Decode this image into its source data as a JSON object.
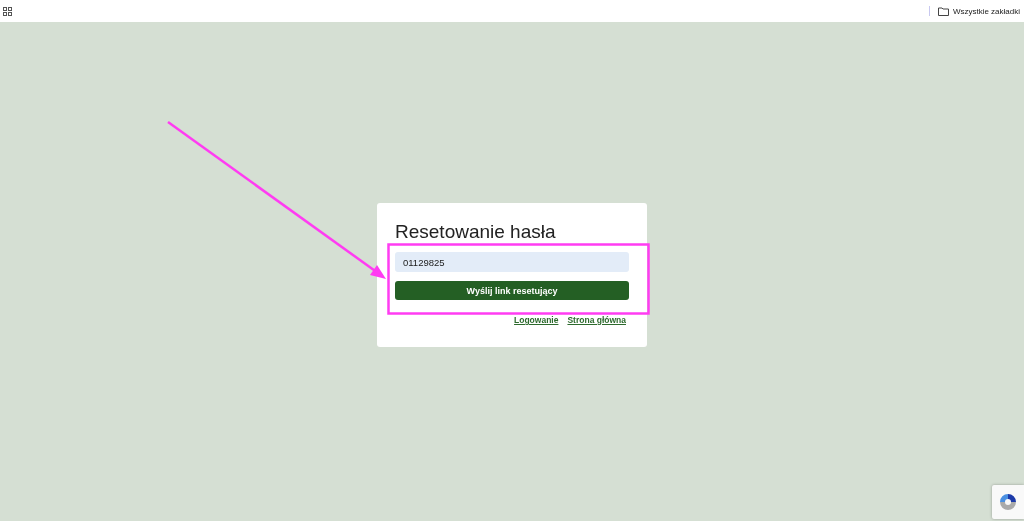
{
  "bookmarks_bar": {
    "all_bookmarks": "Wszystkie zakładki"
  },
  "reset_form": {
    "title": "Resetowanie hasła",
    "login_field": {
      "value": "01129825"
    },
    "submit_button": "Wyślij link resetujący",
    "links": [
      "Logowanie",
      "Strona główna"
    ]
  }
}
